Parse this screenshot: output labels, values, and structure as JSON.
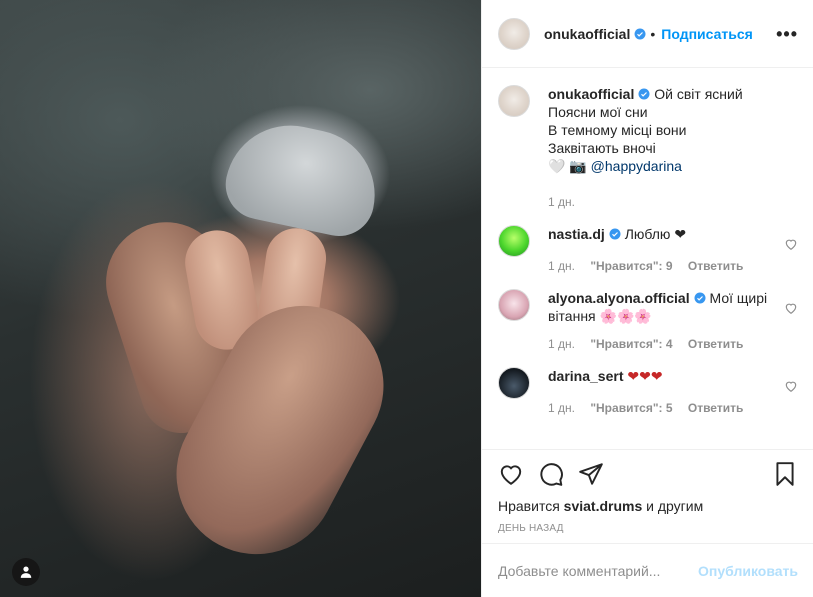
{
  "colors": {
    "link_blue": "#0095f6",
    "verified_blue": "#3897f0",
    "emoji_heart": "#c62828",
    "muted": "#8e8e8e",
    "publish_disabled": "#b2dffc"
  },
  "header": {
    "username": "onukaofficial",
    "separator": "•",
    "follow_label": "Подписаться",
    "more_label": "•••"
  },
  "caption": {
    "username": "onukaofficial",
    "lines": [
      "Ой світ ясний",
      "Поясни мої сни",
      "В темному місці вони",
      "Заквітають вночі"
    ],
    "emoji_line_prefix": "🤍 📷",
    "mention": "@happydarina",
    "time": "1 дн."
  },
  "comments": [
    {
      "username": "nastia.dj",
      "text": "Люблю ❤",
      "time": "1 дн.",
      "likes": "\"Нравится\": 9",
      "reply": "Ответить"
    },
    {
      "username": "alyona.alyona.official",
      "text": "Мої щирі вітання 🌸🌸🌸",
      "time": "1 дн.",
      "likes": "\"Нравится\": 4",
      "reply": "Ответить"
    },
    {
      "username": "darina_sert",
      "text": "❤❤❤",
      "time": "1 дн.",
      "likes": "\"Нравится\": 5",
      "reply": "Ответить"
    }
  ],
  "likes_line": {
    "prefix": "Нравится",
    "user": "sviat.drums",
    "suffix": "и другим"
  },
  "posted_time": "ДЕНЬ НАЗАД",
  "add_comment": {
    "placeholder": "Добавьте комментарий...",
    "publish_label": "Опубликовать"
  },
  "icons": [
    "heart-icon",
    "comment-icon",
    "share-icon",
    "bookmark-icon",
    "user-icon",
    "verified-icon"
  ]
}
